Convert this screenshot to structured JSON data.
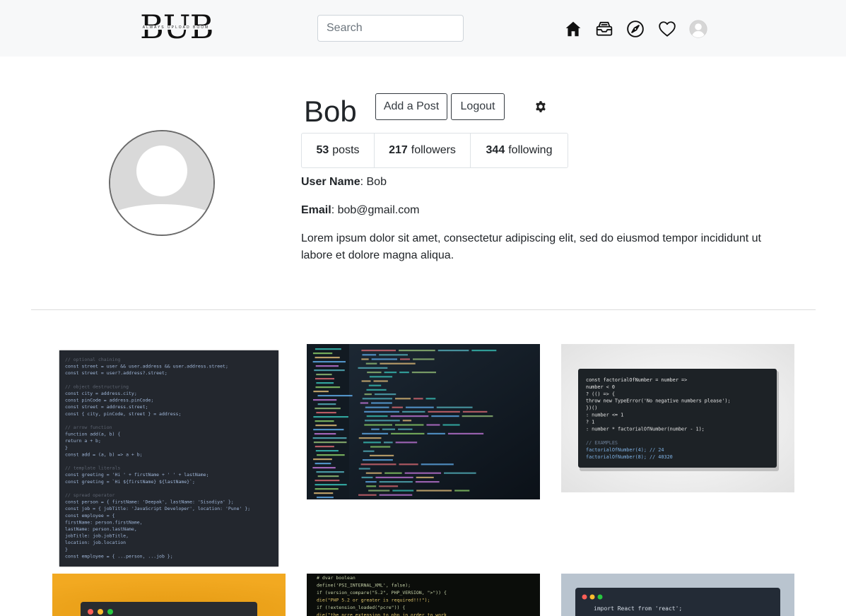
{
  "brand": {
    "logo_text": "BUB",
    "logo_tagline": "ALWAYS UPLOAD BOOM"
  },
  "search": {
    "placeholder": "Search"
  },
  "nav": {
    "icons": [
      "home-icon",
      "inbox-icon",
      "explore-icon",
      "heart-icon",
      "avatar-icon"
    ]
  },
  "profile": {
    "username": "Bob",
    "add_post_label": "Add a Post",
    "logout_label": "Logout",
    "stats": {
      "posts_count": "53",
      "posts_label": "posts",
      "followers_count": "217",
      "followers_label": "followers",
      "following_count": "344",
      "following_label": "following"
    },
    "user_name_label": "User Name",
    "user_name_value": ": Bob",
    "email_label": "Email",
    "email_value": ": bob@gmail.com",
    "bio": "Lorem ipsum dolor sit amet, consectetur adipiscing elit, sed do eiusmod tempor incididunt ut labore et dolore magna aliqua."
  },
  "posts": {
    "post1": {
      "lines": [
        "// optional chaining",
        "const street = user && user.address && user.address.street;",
        "const street = user?.address?.street;",
        "",
        "// object destructuring",
        "const city = address.city;",
        "const pinCode = address.pinCode;",
        "const street = address.street;",
        "const { city, pinCode, street } = address;",
        "",
        "// arrow function",
        "function add(a, b) {",
        "  return a + b;",
        "}",
        "const add = (a, b) => a + b;",
        "",
        "// template literals",
        "const greeting = 'Hi ' + firstName + ' ' + lastName;",
        "const greeting = `Hi ${firstName} ${lastName}`;",
        "",
        "// spread operator",
        "const person = { firstName: 'Deepak', lastName: 'Sisodiya' };",
        "const job = { jobTitle: 'JavaScript Developer', location: 'Pune' };",
        "const employee = {",
        "  firstName: person.firstName,",
        "  lastName: person.lastName,",
        "  jobTitle: job.jobTitle,",
        "  location: job.location",
        "}",
        "const employee = { ...person, ...job };"
      ]
    },
    "post3": {
      "lines": [
        "const factorialOfNumber = number =>",
        "  number < 0",
        "    ? (() => {",
        "      throw new TypeError('No negative numbers please');",
        "    })()",
        "    : number <= 1",
        "      ? 1",
        "      : number * factorialOfNumber(number - 1);",
        "",
        "// EXAMPLES",
        "factorialOfNumber(4); // 24",
        "factorialOfNumber(8); // 40320"
      ]
    },
    "post5": {
      "lines": [
        "# dvar boolean",
        "define('PSI_INTERNAL_XML', false);",
        "if (version_compare(\"5.2\", PHP_VERSION, \">\")) {",
        "  die(\"PHP 5.2 or greater is required!!!\");",
        "if (!extension_loaded(\"pcre\")) {",
        "  die(\"the pcre extension to php in order to work"
      ]
    },
    "post6": {
      "lines": [
        "import React from 'react';"
      ]
    }
  }
}
